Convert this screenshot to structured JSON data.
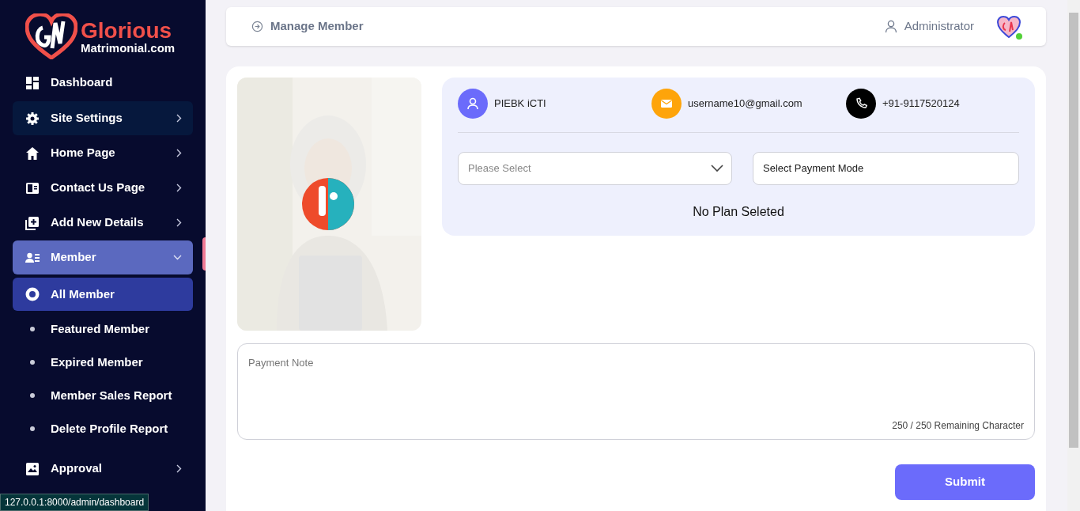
{
  "brand": {
    "name": "Glorious",
    "domain": "Matrimonial.com"
  },
  "sidebar": {
    "items": [
      {
        "label": "Dashboard",
        "hovered": false,
        "selected": false
      },
      {
        "label": "Site Settings",
        "expanded": false,
        "hovered": true,
        "selected": false
      },
      {
        "label": "Home Page",
        "expanded": false,
        "hovered": false,
        "selected": false
      },
      {
        "label": "Contact Us Page",
        "expanded": false,
        "hovered": false,
        "selected": false
      },
      {
        "label": "Add New Details",
        "expanded": false,
        "hovered": false,
        "selected": false
      },
      {
        "label": "Member",
        "hovered": false,
        "selected": true,
        "expanded": true,
        "children": [
          {
            "label": "All Member",
            "selected": true
          },
          {
            "label": "Featured Member",
            "selected": false
          },
          {
            "label": "Expired Member",
            "selected": false
          },
          {
            "label": "Member Sales Report",
            "selected": false
          },
          {
            "label": "Delete Profile Report",
            "selected": false
          }
        ]
      },
      {
        "label": "Approval",
        "expanded": false,
        "hovered": false,
        "selected": false
      }
    ]
  },
  "header": {
    "title": "Manage Member",
    "user": "Administrator",
    "online": true
  },
  "member": {
    "name": "PIEBK iCTI",
    "email": "username10@gmail.com",
    "phone": "+91-9117520124"
  },
  "plan_select": {
    "placeholder": "Please Select"
  },
  "payment_mode": {
    "value": "Select Payment Mode"
  },
  "plan_status": "No Plan Seleted",
  "payment_note": {
    "placeholder": "Payment Note",
    "counter": "250 / 250 Remaining Character"
  },
  "submit": "Submit",
  "status_url": "127.0.0.1:8000/admin/dashboard"
}
